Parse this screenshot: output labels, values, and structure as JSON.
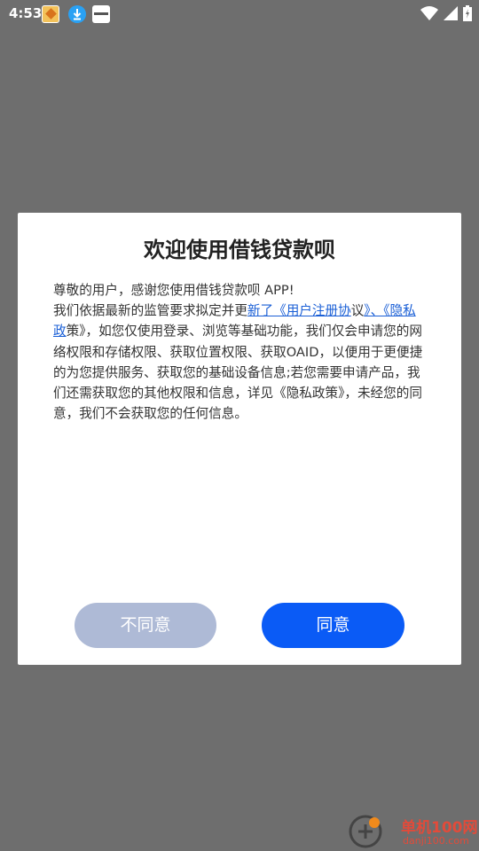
{
  "status_bar": {
    "time": "4:53"
  },
  "dialog": {
    "title": "欢迎使用借钱贷款呗",
    "line1": "尊敬的用户，感谢您使用借钱贷款呗 APP!",
    "body_prefix": "我们依据最新的监管要求拟定并更",
    "link1": "新了《用户注册协",
    "body_mid": "议",
    "link2": "》、《隐私政",
    "body_suffix": "策》，如您仅使用登录、浏览等基础功能，我们仅会申请您的网络权限和存储权限、获取位置权限、获取OAID，以便用于更便捷的为您提供服务、获取您的基础设备信息;若您需要申请产品，我们还需获取您的其他权限和信息，详见《隐私政策》，未经您的同意，我们不会获取您的任何信息。",
    "disagree_label": "不同意",
    "agree_label": "同意"
  },
  "watermark": {
    "title": "单机100网",
    "subtitle": "danji100.com"
  },
  "colors": {
    "overlay": "#6e6e6e",
    "link": "#1a5fd6",
    "agree": "#0a5bf6",
    "disagree": "#aebad6"
  },
  "icons": [
    "wifi-icon",
    "signal-icon",
    "battery-icon",
    "download-icon"
  ]
}
